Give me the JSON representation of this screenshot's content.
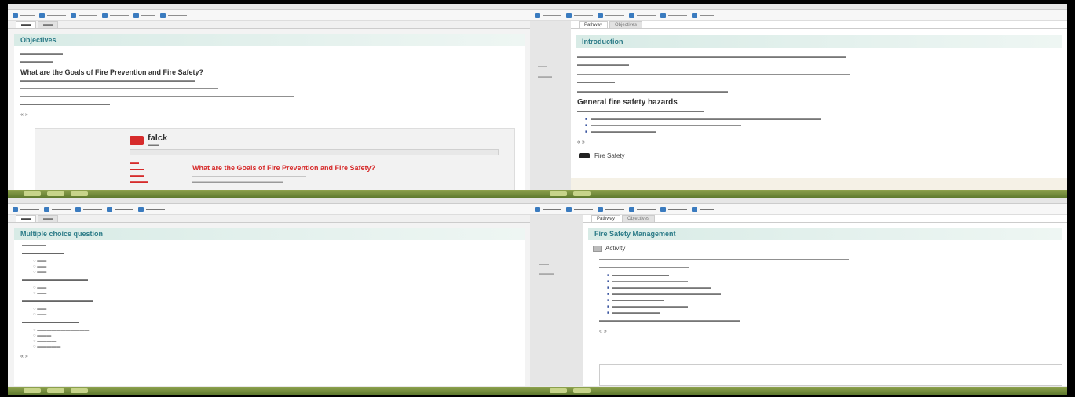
{
  "top_left": {
    "section_title": "Objectives",
    "heading": "What are the Goals of Fire Prevention and Fire Safety?",
    "nav": "&laquo; &raquo;",
    "embed": {
      "logo_name": "falck",
      "red_title": "What are the Goals of Fire Prevention and Fire Safety?"
    }
  },
  "top_right": {
    "tabs": [
      "Pathway",
      "Objectives"
    ],
    "section_title": "Introduction",
    "heading": "General fire safety hazards",
    "nav": "&laquo; &raquo;",
    "banner": "Fire Safety"
  },
  "bottom_left": {
    "section_title": "Multiple choice question",
    "nav": "&laquo; &raquo;"
  },
  "bottom_right": {
    "tabs": [
      "Pathway",
      "Objectives"
    ],
    "section_title": "Fire Safety Management",
    "activity_label": "Activity",
    "nav": "&laquo; &raquo;"
  },
  "colors": {
    "accent": "#2d7c88",
    "header_bg": "#d8ebe6",
    "taskbar": "#6f8a38",
    "falck_red": "#d62b2b"
  },
  "icons": [
    "falck-logo-icon",
    "bookmark-icon",
    "activity-icon",
    "fire-safety-icon"
  ]
}
